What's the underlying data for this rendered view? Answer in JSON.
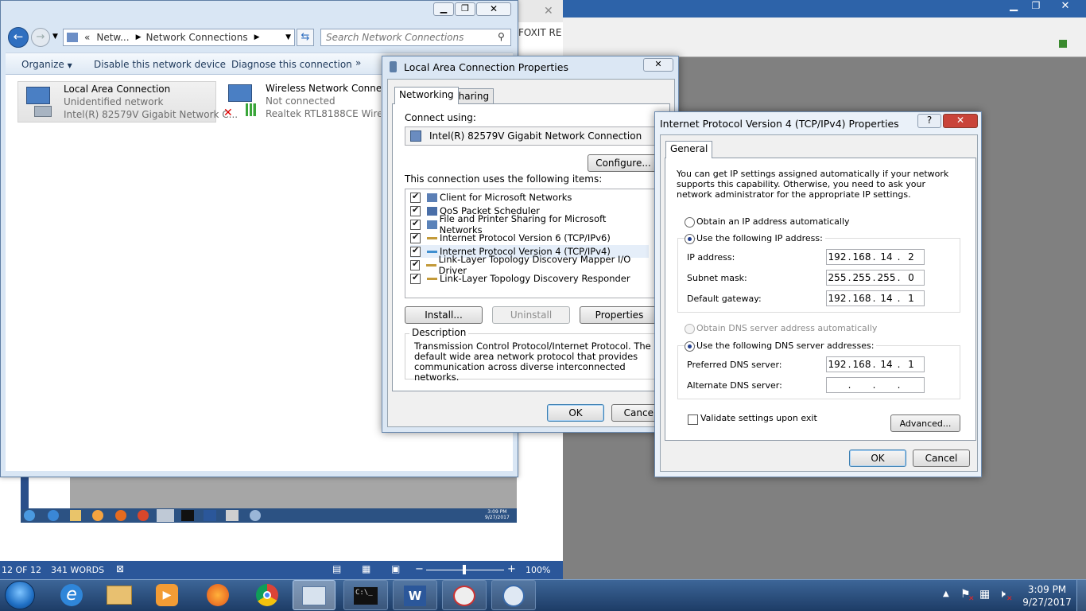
{
  "explorer": {
    "breadcrumb": [
      "Netw...",
      "Network Connections"
    ],
    "search_placeholder": "Search Network Connections",
    "toolbar": {
      "organize": "Organize",
      "disable": "Disable this network device",
      "diagnose": "Diagnose this connection",
      "more": "»"
    },
    "adapters": [
      {
        "name": "Local Area Connection",
        "status": "Unidentified network",
        "device": "Intel(R) 82579V Gigabit Network C..."
      },
      {
        "name": "Wireless Network Connectio",
        "status": "Not connected",
        "device": "Realtek RTL8188CE Wireless"
      }
    ]
  },
  "background_app": {
    "right_panel_text": "FOXIT RE"
  },
  "word": {
    "status": {
      "page": "12 OF 12",
      "words": "341 WORDS",
      "zoom": "100%"
    },
    "embedded_taskbar": {
      "time": "3:09 PM",
      "date": "9/27/2017"
    }
  },
  "lan_props": {
    "title": "Local Area Connection Properties",
    "tabs": [
      "Networking",
      "Sharing"
    ],
    "connect_using_label": "Connect using:",
    "adapter": "Intel(R) 82579V Gigabit Network Connection",
    "configure": "Configure...",
    "items_label": "This connection uses the following items:",
    "items": [
      {
        "label": "Client for Microsoft Networks",
        "checked": true
      },
      {
        "label": "QoS Packet Scheduler",
        "checked": true
      },
      {
        "label": "File and Printer Sharing for Microsoft Networks",
        "checked": true
      },
      {
        "label": "Internet Protocol Version 6 (TCP/IPv6)",
        "checked": true
      },
      {
        "label": "Internet Protocol Version 4 (TCP/IPv4)",
        "checked": true
      },
      {
        "label": "Link-Layer Topology Discovery Mapper I/O Driver",
        "checked": true
      },
      {
        "label": "Link-Layer Topology Discovery Responder",
        "checked": true
      }
    ],
    "install": "Install...",
    "uninstall": "Uninstall",
    "properties": "Properties",
    "description_title": "Description",
    "description": "Transmission Control Protocol/Internet Protocol. The default wide area network protocol that provides communication across diverse interconnected networks.",
    "ok": "OK",
    "cancel": "Cancel"
  },
  "ipv4": {
    "title": "Internet Protocol Version 4 (TCP/IPv4) Properties",
    "help": "?",
    "tab": "General",
    "intro": "You can get IP settings assigned automatically if your network supports this capability. Otherwise, you need to ask your network administrator for the appropriate IP settings.",
    "auto_ip": "Obtain an IP address automatically",
    "manual_ip": "Use the following IP address:",
    "ip_label": "IP address:",
    "ip": [
      "192",
      "168",
      "14",
      "2"
    ],
    "mask_label": "Subnet mask:",
    "mask": [
      "255",
      "255",
      "255",
      "0"
    ],
    "gw_label": "Default gateway:",
    "gw": [
      "192",
      "168",
      "14",
      "1"
    ],
    "auto_dns": "Obtain DNS server address automatically",
    "manual_dns": "Use the following DNS server addresses:",
    "pref_label": "Preferred DNS server:",
    "pref": [
      "192",
      "168",
      "14",
      "1"
    ],
    "alt_label": "Alternate DNS server:",
    "validate": "Validate settings upon exit",
    "advanced": "Advanced...",
    "ok": "OK",
    "cancel": "Cancel"
  },
  "taskbar": {
    "time": "3:09 PM",
    "date": "9/27/2017"
  },
  "colors": {
    "taskbar": "#1f3f6b",
    "word_blue": "#2b579a",
    "desktop_gray": "#7f7f7f"
  }
}
